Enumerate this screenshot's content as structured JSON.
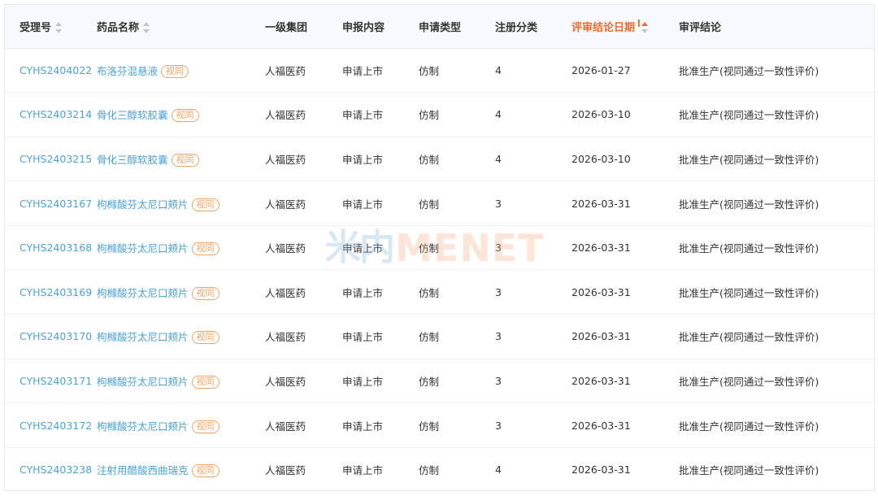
{
  "headers": {
    "acceptance_no": "受理号",
    "drug_name": "药品名称",
    "group": "一级集团",
    "content": "申报内容",
    "apply_type": "申请类型",
    "reg_class": "注册分类",
    "review_date": "评审结论日期",
    "conclusion": "审评结论"
  },
  "accent_color": "#f06b2b",
  "link_color": "#4aa3d9",
  "watermark": {
    "logo": "米内",
    "text": "MENET"
  },
  "rows": [
    {
      "id": "CYHS2404022",
      "name": "布洛芬混悬液",
      "badge": "视同",
      "group": "人福医药",
      "content": "申请上市",
      "type": "仿制",
      "class": "4",
      "date": "2026-01-27",
      "result": "批准生产(视同通过一致性评价)"
    },
    {
      "id": "CYHS2403214",
      "name": "骨化三醇软胶囊",
      "badge": "视同",
      "group": "人福医药",
      "content": "申请上市",
      "type": "仿制",
      "class": "4",
      "date": "2026-03-10",
      "result": "批准生产(视同通过一致性评价)"
    },
    {
      "id": "CYHS2403215",
      "name": "骨化三醇软胶囊",
      "badge": "视同",
      "group": "人福医药",
      "content": "申请上市",
      "type": "仿制",
      "class": "4",
      "date": "2026-03-10",
      "result": "批准生产(视同通过一致性评价)"
    },
    {
      "id": "CYHS2403167",
      "name": "枸橼酸芬太尼口颊片",
      "badge": "视同",
      "group": "人福医药",
      "content": "申请上市",
      "type": "仿制",
      "class": "3",
      "date": "2026-03-31",
      "result": "批准生产(视同通过一致性评价)"
    },
    {
      "id": "CYHS2403168",
      "name": "枸橼酸芬太尼口颊片",
      "badge": "视同",
      "group": "人福医药",
      "content": "申请上市",
      "type": "仿制",
      "class": "3",
      "date": "2026-03-31",
      "result": "批准生产(视同通过一致性评价)"
    },
    {
      "id": "CYHS2403169",
      "name": "枸橼酸芬太尼口颊片",
      "badge": "视同",
      "group": "人福医药",
      "content": "申请上市",
      "type": "仿制",
      "class": "3",
      "date": "2026-03-31",
      "result": "批准生产(视同通过一致性评价)"
    },
    {
      "id": "CYHS2403170",
      "name": "枸橼酸芬太尼口颊片",
      "badge": "视同",
      "group": "人福医药",
      "content": "申请上市",
      "type": "仿制",
      "class": "3",
      "date": "2026-03-31",
      "result": "批准生产(视同通过一致性评价)"
    },
    {
      "id": "CYHS2403171",
      "name": "枸橼酸芬太尼口颊片",
      "badge": "视同",
      "group": "人福医药",
      "content": "申请上市",
      "type": "仿制",
      "class": "3",
      "date": "2026-03-31",
      "result": "批准生产(视同通过一致性评价)"
    },
    {
      "id": "CYHS2403172",
      "name": "枸橼酸芬太尼口颊片",
      "badge": "视同",
      "group": "人福医药",
      "content": "申请上市",
      "type": "仿制",
      "class": "3",
      "date": "2026-03-31",
      "result": "批准生产(视同通过一致性评价)"
    },
    {
      "id": "CYHS2403238",
      "name": "注射用醋酸西曲瑞克",
      "badge": "视同",
      "group": "人福医药",
      "content": "申请上市",
      "type": "仿制",
      "class": "4",
      "date": "2026-03-31",
      "result": "批准生产(视同通过一致性评价)"
    }
  ]
}
